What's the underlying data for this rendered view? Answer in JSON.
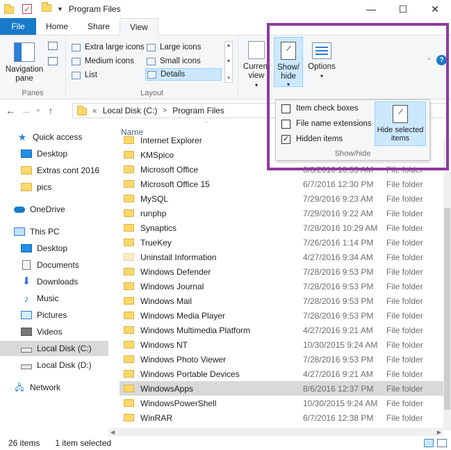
{
  "window": {
    "title": "Program Files",
    "minimize": "—",
    "maximize": "☐",
    "close": "✕"
  },
  "ribbon": {
    "tabs": [
      "File",
      "Home",
      "Share",
      "View"
    ],
    "panes": {
      "navigation_pane": "Navigation pane",
      "label": "Panes"
    },
    "layout": {
      "items": [
        "Extra large icons",
        "Large icons",
        "Medium icons",
        "Small icons",
        "List",
        "Details"
      ],
      "selected": "Details",
      "label": "Layout"
    },
    "current_view": "Current view",
    "show_hide": "Show/ hide",
    "options": "Options"
  },
  "dropdown": {
    "item_check_boxes": "Item check boxes",
    "file_name_extensions": "File name extensions",
    "hidden_items": "Hidden items",
    "hidden_items_checked": true,
    "hide_selected_items": "Hide selected items",
    "label": "Show/hide"
  },
  "address": {
    "overflow": "«",
    "crumbs": [
      "Local Disk (C:)",
      "Program Files"
    ]
  },
  "nav": {
    "items": [
      {
        "label": "Quick access",
        "icon": "star-icon"
      },
      {
        "label": "Desktop",
        "icon": "desktop-icon"
      },
      {
        "label": "Extras cont 2016",
        "icon": "folder-icon"
      },
      {
        "label": "pics",
        "icon": "folder-icon"
      },
      {
        "label": "OneDrive",
        "icon": "cloud-icon"
      },
      {
        "label": "This PC",
        "icon": "computer-icon"
      },
      {
        "label": "Desktop",
        "icon": "desktop-icon"
      },
      {
        "label": "Documents",
        "icon": "documents-icon"
      },
      {
        "label": "Downloads",
        "icon": "download-icon"
      },
      {
        "label": "Music",
        "icon": "music-icon"
      },
      {
        "label": "Pictures",
        "icon": "pictures-icon"
      },
      {
        "label": "Videos",
        "icon": "videos-icon"
      },
      {
        "label": "Local Disk (C:)",
        "icon": "drive-icon"
      },
      {
        "label": "Local Disk (D:)",
        "icon": "drive-icon"
      },
      {
        "label": "Network",
        "icon": "network-icon"
      }
    ],
    "selected": "Local Disk (C:)"
  },
  "files": {
    "column_name": "Name",
    "rows": [
      {
        "name": "Internet Explorer",
        "date": "",
        "type": ""
      },
      {
        "name": "KMSpico",
        "date": "",
        "type": ""
      },
      {
        "name": "Microsoft Office",
        "date": "8/6/2016 10:53 AM",
        "type": "File folder"
      },
      {
        "name": "Microsoft Office 15",
        "date": "6/7/2016 12:30 PM",
        "type": "File folder"
      },
      {
        "name": "MySQL",
        "date": "7/29/2016 9:23 AM",
        "type": "File folder"
      },
      {
        "name": "runphp",
        "date": "7/29/2016 9:22 AM",
        "type": "File folder"
      },
      {
        "name": "Synaptics",
        "date": "7/28/2016 10:29 AM",
        "type": "File folder"
      },
      {
        "name": "TrueKey",
        "date": "7/26/2016 1:14 PM",
        "type": "File folder"
      },
      {
        "name": "Uninstall Information",
        "date": "4/27/2016 9:34 AM",
        "type": "File folder"
      },
      {
        "name": "Windows Defender",
        "date": "7/28/2016 9:53 PM",
        "type": "File folder"
      },
      {
        "name": "Windows Journal",
        "date": "7/28/2016 9:53 PM",
        "type": "File folder"
      },
      {
        "name": "Windows Mail",
        "date": "7/28/2016 9:53 PM",
        "type": "File folder"
      },
      {
        "name": "Windows Media Player",
        "date": "7/28/2016 9:53 PM",
        "type": "File folder"
      },
      {
        "name": "Windows Multimedia Platform",
        "date": "4/27/2016 9:21 AM",
        "type": "File folder"
      },
      {
        "name": "Windows NT",
        "date": "10/30/2015 9:24 AM",
        "type": "File folder"
      },
      {
        "name": "Windows Photo Viewer",
        "date": "7/28/2016 9:53 PM",
        "type": "File folder"
      },
      {
        "name": "Windows Portable Devices",
        "date": "4/27/2016 9:21 AM",
        "type": "File folder"
      },
      {
        "name": "WindowsApps",
        "date": "8/6/2016 12:37 PM",
        "type": "File folder"
      },
      {
        "name": "WindowsPowerShell",
        "date": "10/30/2015 9:24 AM",
        "type": "File folder"
      },
      {
        "name": "WinRAR",
        "date": "6/7/2016 12:38 PM",
        "type": "File folder"
      }
    ],
    "selected": "WindowsApps"
  },
  "status": {
    "count": "26 items",
    "selection": "1 item selected"
  },
  "colors": {
    "accent": "#1979ca",
    "highlight_box": "#8e3a9e",
    "selection": "#cce8ff"
  }
}
